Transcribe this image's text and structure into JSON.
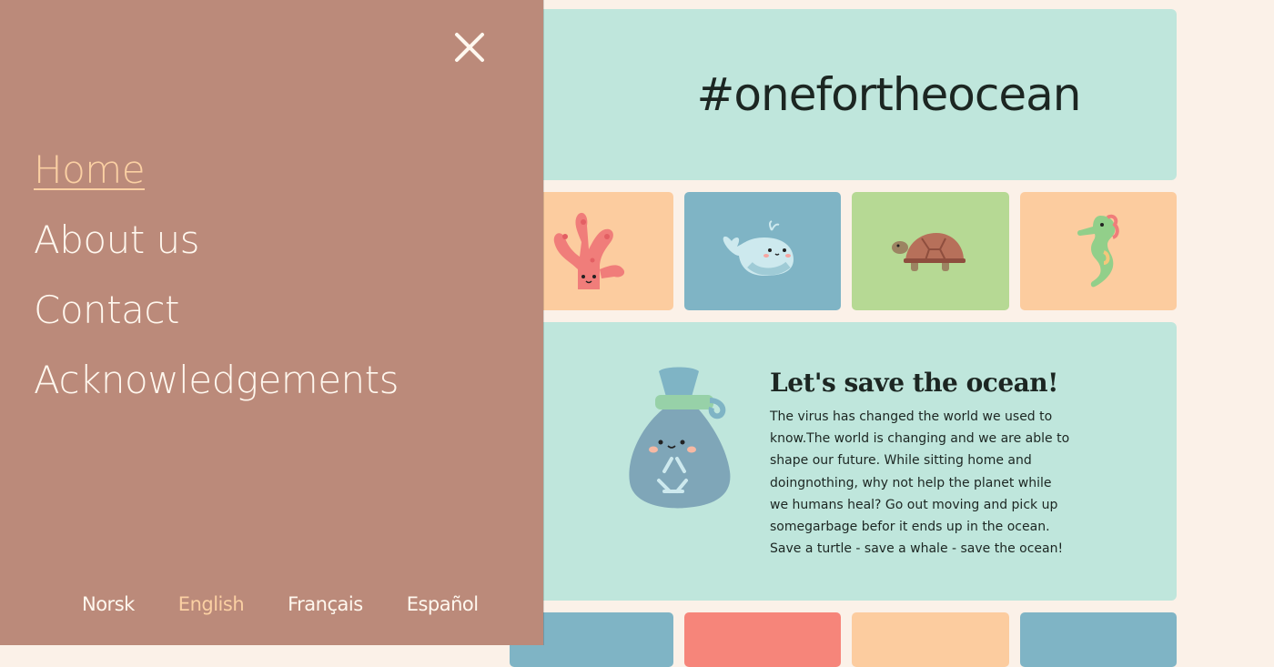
{
  "hero": {
    "title": "#onefortheocean"
  },
  "tiles_row1": [
    {
      "name": "coral",
      "bg": "#fccc9f"
    },
    {
      "name": "whale",
      "bg": "#7fb4c5"
    },
    {
      "name": "turtle",
      "bg": "#b6d994"
    },
    {
      "name": "seahorse",
      "bg": "#fccc9f"
    }
  ],
  "tiles_row2": [
    {
      "bg": "#7fb4c5"
    },
    {
      "bg": "#f6857a"
    },
    {
      "bg": "#fccc9f"
    },
    {
      "bg": "#7fb4c5"
    }
  ],
  "article": {
    "heading": "Let's save the ocean!",
    "body": "The virus has changed the world we used to know.The world is changing and we are able to shape our future. While sitting home and doingnothing, why not help the planet while we humans heal? Go out moving and pick up somegarbage befor it ends up in the ocean. Save a turtle - save a whale - save the ocean!"
  },
  "drawer": {
    "nav": [
      {
        "label": "Home",
        "active": true
      },
      {
        "label": "About us",
        "active": false
      },
      {
        "label": "Contact",
        "active": false
      },
      {
        "label": "Acknowledgements",
        "active": false
      }
    ],
    "languages": [
      {
        "label": "Norsk",
        "active": false
      },
      {
        "label": "English",
        "active": true
      },
      {
        "label": "Français",
        "active": false
      },
      {
        "label": "Español",
        "active": false
      }
    ],
    "icons": {
      "close": "close-icon",
      "language": "globe-icon"
    }
  },
  "colors": {
    "drawer_bg": "#bb8a7a",
    "accent": "#fbd0a3",
    "mint": "#bfe6dc",
    "page_bg": "#fbf1e8"
  }
}
